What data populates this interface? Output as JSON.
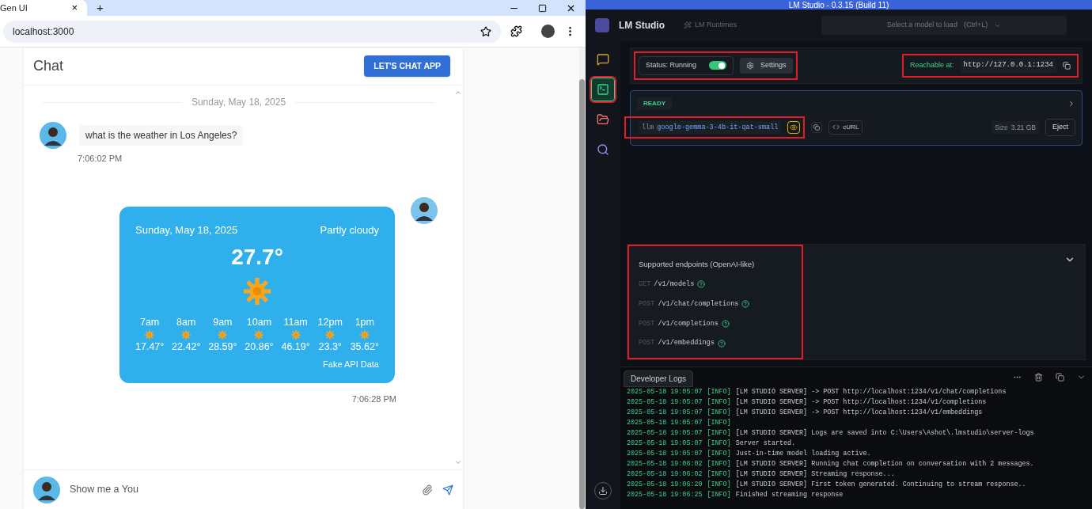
{
  "browser": {
    "tab": {
      "title": "Gen UI",
      "close": "×"
    },
    "new_tab": "+",
    "address": "localhost:3000"
  },
  "chat": {
    "title": "Chat",
    "header_button": "LET'S CHAT APP",
    "date": "Sunday, May 18, 2025",
    "messages": [
      {
        "kind": "text",
        "text": "what is the weather in Los Angeles?",
        "time": "7:06:02 PM"
      },
      {
        "kind": "weather",
        "time": "7:06:28 PM",
        "weather": {
          "date": "Sunday, May 18, 2025",
          "condition": "Partly cloudy",
          "temperature": "27.7°",
          "source": "Fake API Data",
          "hours": [
            {
              "time": "7am",
              "temp": "17.47°"
            },
            {
              "time": "8am",
              "temp": "22.42°"
            },
            {
              "time": "9am",
              "temp": "28.59°"
            },
            {
              "time": "10am",
              "temp": "20.86°"
            },
            {
              "time": "11am",
              "temp": "46.19°"
            },
            {
              "time": "12pm",
              "temp": "23.3°"
            },
            {
              "time": "1pm",
              "temp": "35.62°"
            }
          ]
        }
      }
    ],
    "input": {
      "value": "Show me a You"
    }
  },
  "lmstudio": {
    "title": "LM Studio - 0.3.15 (Build 11)",
    "app_name": "LM Studio",
    "runtimes": "LM Runtimes",
    "model_picker": {
      "placeholder": "Select a model to load",
      "shortcut": "(Ctrl+L)"
    },
    "sidebar": [
      {
        "kind": "chat",
        "selected": false
      },
      {
        "kind": "developer",
        "selected": true
      },
      {
        "kind": "folder",
        "selected": false
      },
      {
        "kind": "search",
        "selected": false
      }
    ],
    "server": {
      "status": "Status: Running",
      "on": true,
      "settings": "Settings",
      "reachable_label": "Reachable at:",
      "url": "http://127.0.0.1:1234"
    },
    "model": {
      "state": "READY",
      "prefix": "llm",
      "name": "google-gemma-3-4b-it-qat-small",
      "curl": "cURL",
      "size_label": "Size",
      "size": "3.21 GB",
      "eject": "Eject"
    },
    "endpoints": {
      "title": "Supported endpoints (OpenAI-like)",
      "items": [
        {
          "method": "GET",
          "path": "/v1/models"
        },
        {
          "method": "POST",
          "path": "/v1/chat/completions"
        },
        {
          "method": "POST",
          "path": "/v1/completions"
        },
        {
          "method": "POST",
          "path": "/v1/embeddings"
        }
      ]
    },
    "logs": {
      "title": "Developer Logs",
      "lines": [
        {
          "time": "2025-05-18 19:05:07",
          "level": "[INFO]",
          "text": "[LM STUDIO SERVER] -> POST http://localhost:1234/v1/chat/completions"
        },
        {
          "time": "2025-05-18 19:05:07",
          "level": "[INFO]",
          "text": "[LM STUDIO SERVER] -> POST http://localhost:1234/v1/completions"
        },
        {
          "time": "2025-05-18 19:05:07",
          "level": "[INFO]",
          "text": "[LM STUDIO SERVER] -> POST http://localhost:1234/v1/embeddings"
        },
        {
          "time": "2025-05-18 19:05:07",
          "level": "[INFO]"
        },
        {
          "time": "2025-05-18 19:05:07",
          "level": "[INFO]",
          "text": "[LM STUDIO SERVER] Logs are saved into C:\\Users\\Ashot\\.lmstudio\\server-logs"
        },
        {
          "time": "2025-05-18 19:05:07",
          "level": "[INFO]",
          "text": "Server started."
        },
        {
          "time": "2025-05-18 19:05:07",
          "level": "[INFO]",
          "text": "Just-in-time model loading active."
        },
        {
          "time": "2025-05-18 19:06:02",
          "level": "[INFO]",
          "text": "[LM STUDIO SERVER] Running chat completion on conversation with 2 messages."
        },
        {
          "time": "2025-05-18 19:06:02",
          "level": "[INFO]",
          "text": "[LM STUDIO SERVER] Streaming response..."
        },
        {
          "time": "2025-05-18 19:06:20",
          "level": "[INFO]",
          "text": "[LM STUDIO SERVER] First token generated. Continuing to stream response.."
        },
        {
          "time": "2025-05-18 19:06:25",
          "level": "[INFO]",
          "text": "Finished streaming response"
        }
      ]
    }
  }
}
